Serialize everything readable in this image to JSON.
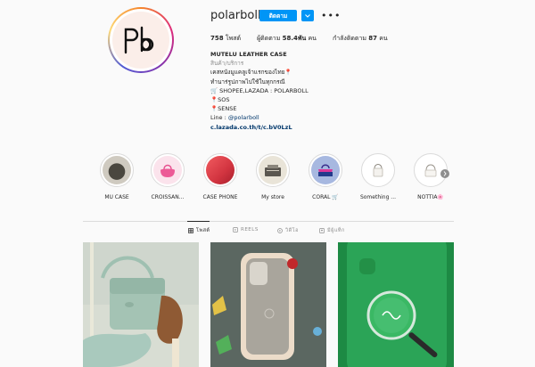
{
  "profile": {
    "username": "polarboll",
    "follow_label": "ติดตาม",
    "stats": [
      {
        "num": "758",
        "label": "โพสต์"
      },
      {
        "label_before": "ผู้ติดตาม",
        "num": "58.4พัน",
        "label": "คน"
      },
      {
        "label_before": "กำลังติดตาม",
        "num": "87",
        "label": "คน"
      }
    ],
    "bio": {
      "name": "MUTELU LEATHER CASE",
      "category": "สินค้า/บริการ",
      "lines": [
        "เคสหนังมูแคลูเจ้าแรกของไทย📍",
        "ทำนาร่รูปภาพไปใช้ในทุกกรณี",
        "🛒 SHOPEE,LAZADA : POLARBOLL",
        "📍SOS",
        "📍SENSE"
      ],
      "line_prefix": "Line : ",
      "line_handle": "@polarboll",
      "link": "c.lazada.co.th/t/c.bV0LzL"
    }
  },
  "highlights": [
    {
      "label": "MU CASE",
      "colors": [
        "#c9c5b8",
        "#3b3a33"
      ]
    },
    {
      "label": "CROISSAN...",
      "colors": [
        "#fbe3ec",
        "#ec5a96"
      ]
    },
    {
      "label": "CASE PHONE",
      "colors": [
        "#f04d54",
        "#b82a35"
      ]
    },
    {
      "label": "My store",
      "colors": [
        "#e9e4d8",
        "#55514a"
      ]
    },
    {
      "label": "CORAL 🛒",
      "colors": [
        "#a7b8e0",
        "#d9379a"
      ]
    },
    {
      "label": "Something ...",
      "colors": [
        "#ffffff",
        "#e4e1dc"
      ]
    },
    {
      "label": "NOTTIA🌸",
      "colors": [
        "#ffffff",
        "#e6e3de"
      ]
    }
  ],
  "tabs": [
    {
      "label": "โพสต์",
      "icon": "grid-icon",
      "active": true
    },
    {
      "label": "REELS",
      "icon": "reels-icon",
      "active": false
    },
    {
      "label": "วิดีโอ",
      "icon": "video-icon",
      "active": false
    },
    {
      "label": "มีผู้แท็ก",
      "icon": "tagged-icon",
      "active": false
    }
  ],
  "posts": [
    {
      "kind": "mint-bag",
      "colors": [
        "#d8ddd3",
        "#a4c3b4",
        "#8f5a34"
      ]
    },
    {
      "kind": "phone-case",
      "colors": [
        "#5e6a63",
        "#e7d7c5",
        "#a9a59c"
      ]
    },
    {
      "kind": "green-case",
      "colors": [
        "#2ba457",
        "#1d8a44",
        "#d6e8dc"
      ]
    }
  ]
}
